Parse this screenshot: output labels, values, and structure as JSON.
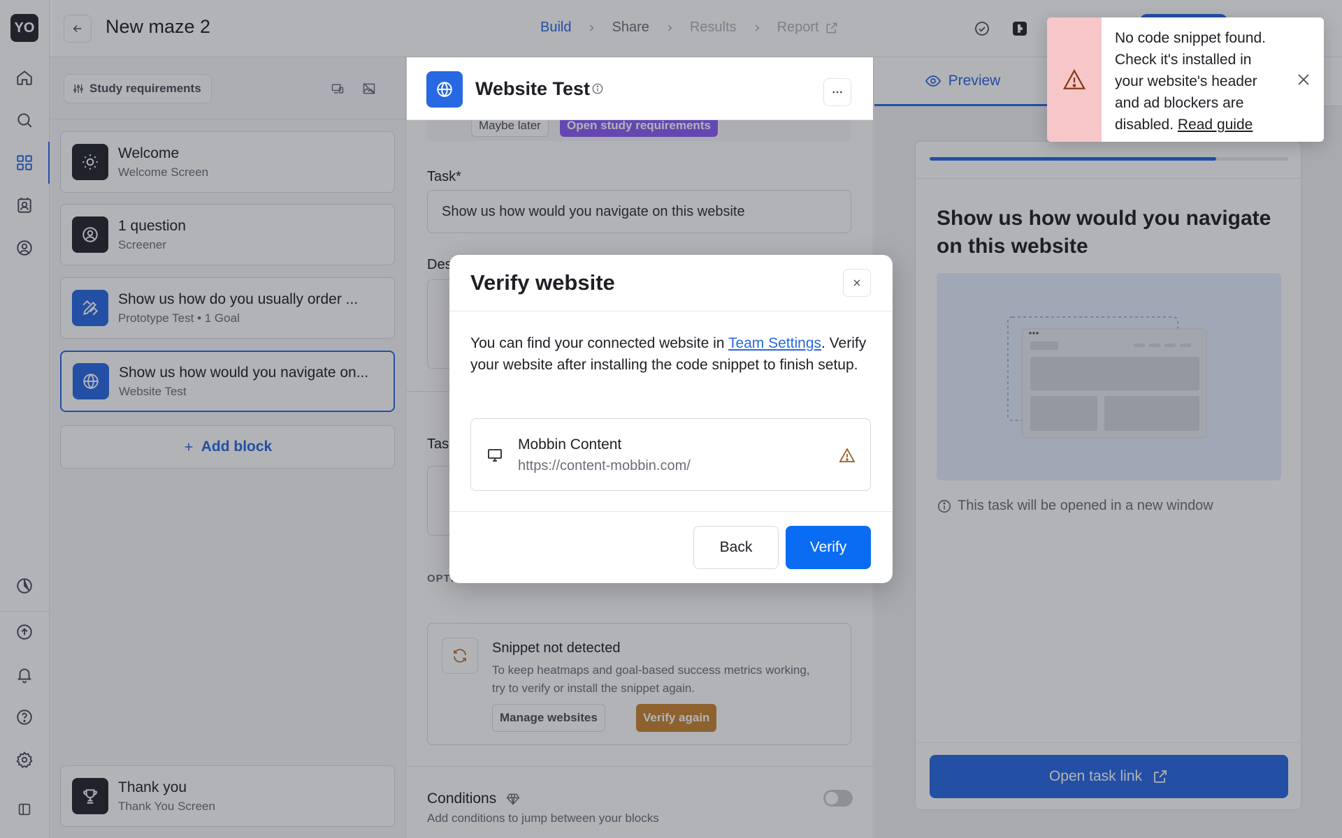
{
  "rail": {
    "logo": "YO",
    "icons": [
      "home-icon",
      "search-icon",
      "grid-icon",
      "contacts-icon",
      "user-settings-icon",
      "chart-pie-icon",
      "upload-icon",
      "bell-icon",
      "help-icon",
      "gear-icon",
      "sidebar-toggle-icon"
    ],
    "accent": "#2768e3"
  },
  "header": {
    "title": "New maze 2",
    "steps": [
      "Build",
      "Share",
      "Results",
      "Report"
    ],
    "current_step": "Build"
  },
  "blocks_panel": {
    "study_requirements_label": "Study requirements",
    "blocks": [
      {
        "title": "Welcome",
        "subtitle": "Welcome Screen",
        "icon": "sun-icon"
      },
      {
        "title": "1 question",
        "subtitle": "Screener",
        "icon": "person-check-icon"
      },
      {
        "title": "Show us how do you usually order ...",
        "subtitle": "Prototype Test • 1 Goal",
        "icon": "pencil-ruler-icon"
      },
      {
        "title": "Show us how would you navigate on...",
        "subtitle": "Website Test",
        "icon": "globe-icon"
      }
    ],
    "add_block_label": "Add block",
    "thank_you": {
      "title": "Thank you",
      "subtitle": "Thank You Screen",
      "icon": "trophy-icon"
    }
  },
  "editor": {
    "title": "Website Test",
    "maybe_later": "Maybe later",
    "open_requirements": "Open study requirements",
    "task_label": "Task*",
    "task_value": "Show us how would you navigate on this website",
    "description_label_partial": "Des",
    "task_link_label_partial": "Tas",
    "optional_label_partial": "OPTI",
    "snippet": {
      "title": "Snippet not detected",
      "description": "To keep heatmaps and goal-based success metrics working, try to verify or install the snippet again.",
      "manage_label": "Manage websites",
      "verify_again_label": "Verify again"
    },
    "conditions_title": "Conditions",
    "conditions_subtitle": "Add conditions to jump between your blocks"
  },
  "preview": {
    "tab_label": "Preview",
    "progress": 0.8,
    "question": "Show us how would you navigate on this website",
    "note": "This task will be opened in a new window",
    "open_task_label": "Open task link"
  },
  "modal": {
    "title": "Verify website",
    "desc_before": "You can find your connected website in ",
    "desc_link": "Team Settings",
    "desc_after": ". Verify your website after installing the code snippet to finish setup.",
    "site_name": "Mobbin Content",
    "site_url": "https://content-mobbin.com/",
    "back_label": "Back",
    "verify_label": "Verify"
  },
  "toast": {
    "message": "No code snippet found. Check it's installed in your website's header and ad blockers are disabled. ",
    "link_label": "Read guide",
    "side_color": "#f7c6c9"
  }
}
